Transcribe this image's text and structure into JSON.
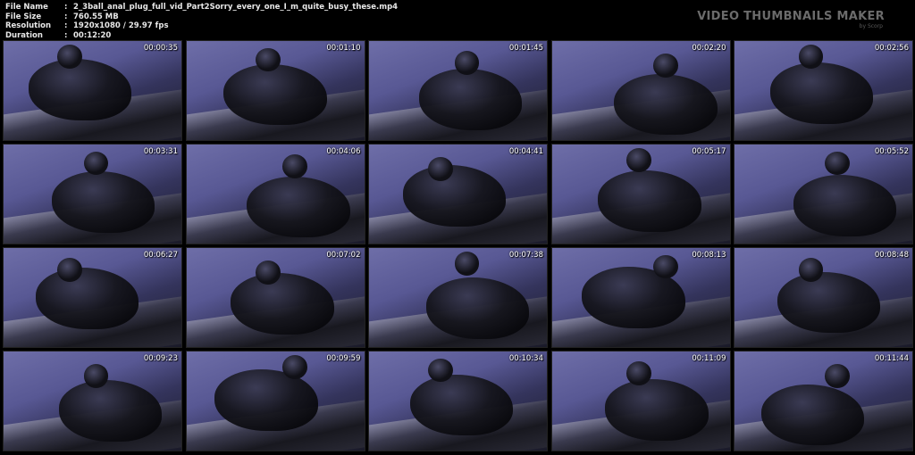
{
  "info": {
    "file_name_label": "File Name",
    "file_name": "2_3ball_anal_plug_full_vid_Part2Sorry_every_one_I_m_quite_busy_these.mp4",
    "file_size_label": "File Size",
    "file_size": "760.55 MB",
    "resolution_label": "Resolution",
    "resolution": "1920x1080 / 29.97 fps",
    "duration_label": "Duration",
    "duration": "00:12:20",
    "separator": ":"
  },
  "brand": {
    "title": "VIDEO THUMBNAILS MAKER",
    "subtitle": "by Scorp"
  },
  "thumbnails": [
    {
      "timestamp": "00:00:35"
    },
    {
      "timestamp": "00:01:10"
    },
    {
      "timestamp": "00:01:45"
    },
    {
      "timestamp": "00:02:20"
    },
    {
      "timestamp": "00:02:56"
    },
    {
      "timestamp": "00:03:31"
    },
    {
      "timestamp": "00:04:06"
    },
    {
      "timestamp": "00:04:41"
    },
    {
      "timestamp": "00:05:17"
    },
    {
      "timestamp": "00:05:52"
    },
    {
      "timestamp": "00:06:27"
    },
    {
      "timestamp": "00:07:02"
    },
    {
      "timestamp": "00:07:38"
    },
    {
      "timestamp": "00:08:13"
    },
    {
      "timestamp": "00:08:48"
    },
    {
      "timestamp": "00:09:23"
    },
    {
      "timestamp": "00:09:59"
    },
    {
      "timestamp": "00:10:34"
    },
    {
      "timestamp": "00:11:09"
    },
    {
      "timestamp": "00:11:44"
    }
  ]
}
